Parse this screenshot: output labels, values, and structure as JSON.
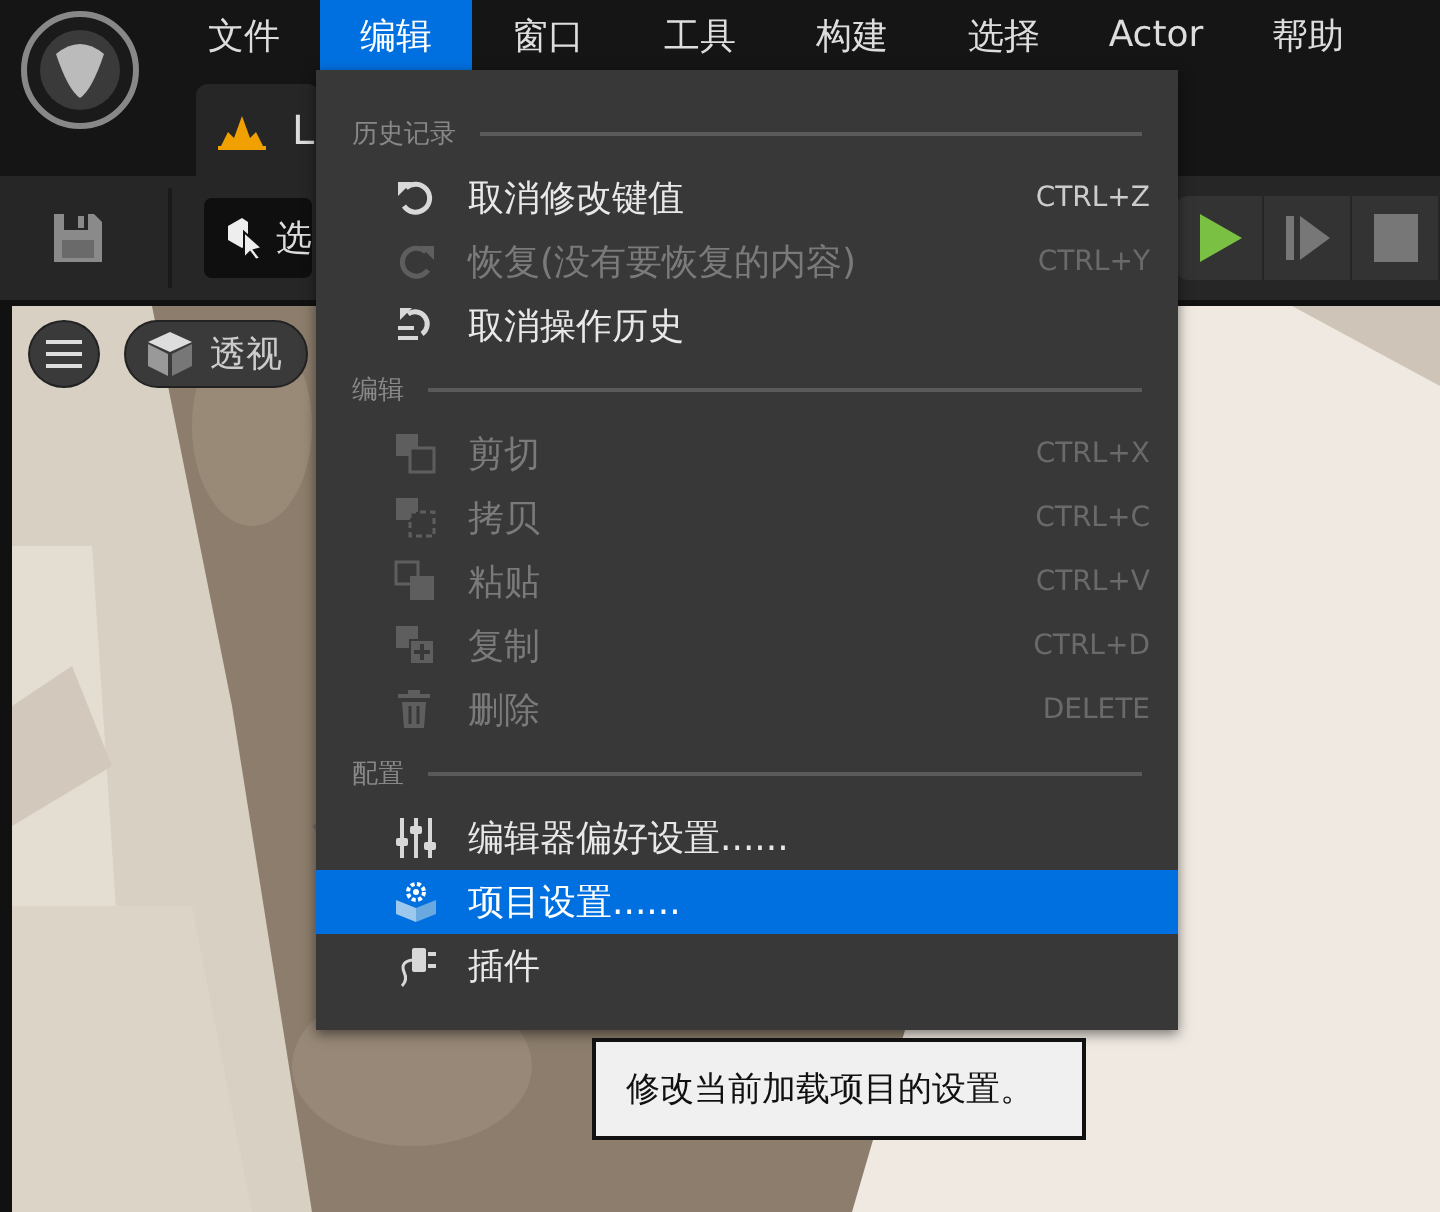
{
  "menubar": {
    "items": [
      {
        "label": "文件",
        "selected": false
      },
      {
        "label": "编辑",
        "selected": true
      },
      {
        "label": "窗口",
        "selected": false
      },
      {
        "label": "工具",
        "selected": false
      },
      {
        "label": "构建",
        "selected": false
      },
      {
        "label": "选择",
        "selected": false
      },
      {
        "label": "Actor",
        "selected": false
      },
      {
        "label": "帮助",
        "selected": false
      }
    ]
  },
  "tab": {
    "label": "L"
  },
  "toolbar": {
    "select_button": "选"
  },
  "viewport": {
    "view_button": "透视"
  },
  "dropdown": {
    "sections": [
      {
        "header": "历史记录",
        "items": [
          {
            "label": "取消修改键值",
            "shortcut": "CTRL+Z",
            "disabled": false,
            "selected": false
          },
          {
            "label": "恢复(没有要恢复的内容)",
            "shortcut": "CTRL+Y",
            "disabled": true,
            "selected": false
          },
          {
            "label": "取消操作历史",
            "disabled": false,
            "selected": false
          }
        ]
      },
      {
        "header": "编辑",
        "items": [
          {
            "label": "剪切",
            "shortcut": "CTRL+X",
            "disabled": true,
            "selected": false
          },
          {
            "label": "拷贝",
            "shortcut": "CTRL+C",
            "disabled": true,
            "selected": false
          },
          {
            "label": "粘贴",
            "shortcut": "CTRL+V",
            "disabled": true,
            "selected": false
          },
          {
            "label": "复制",
            "shortcut": "CTRL+D",
            "disabled": true,
            "selected": false
          },
          {
            "label": "删除",
            "shortcut": "DELETE",
            "disabled": true,
            "selected": false
          }
        ]
      },
      {
        "header": "配置",
        "items": [
          {
            "label": "编辑器偏好设置......",
            "disabled": false,
            "selected": false
          },
          {
            "label": "项目设置......",
            "disabled": false,
            "selected": true
          },
          {
            "label": "插件",
            "disabled": false,
            "selected": false
          }
        ]
      }
    ]
  },
  "tooltip": {
    "text": "修改当前加载项目的设置。"
  }
}
